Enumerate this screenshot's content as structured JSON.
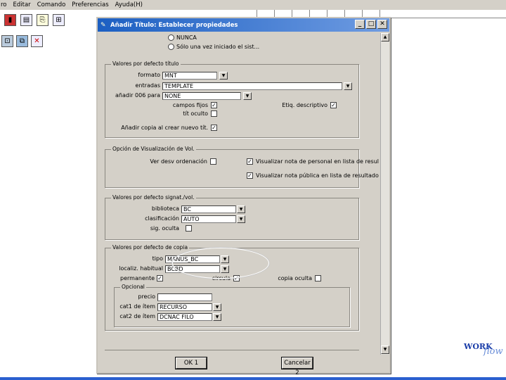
{
  "menu": [
    "ro",
    "Editar",
    "Comando",
    "Preferencias",
    "Ayuda(H)"
  ],
  "dialog": {
    "title": "Añadir Título: Establecer propiedades",
    "radios": [
      "NUNCA",
      "Sólo una vez iniciado el sist..."
    ],
    "defaults_title": {
      "legend": "Valores por defecto título",
      "formato_label": "formato",
      "formato_value": "MNT",
      "entradas_label": "entradas",
      "entradas_value": "TEMPLATE",
      "anadir006_label": "añadir 006 para",
      "anadir006_value": "NONE",
      "campos_fijos_label": "campos fijos",
      "tit_oculto_label": "tít oculto",
      "etiq_descriptivo_label": "Etiq. descriptivo",
      "anadir_copia_label": "Añadir copia al crear nuevo tít."
    },
    "view_options": {
      "legend": "Opción de Visualización de Vol.",
      "ver_orden_label": "Ver desv ordenación",
      "nota_personal_label": "Visualizar nota de personal en lista de resul",
      "nota_publica_label": "Visualizar nota pública en lista de resultado"
    },
    "call_number": {
      "legend": "Valores por defecto signat./vol.",
      "biblioteca_label": "biblioteca",
      "biblioteca_value": "BC",
      "clasificacion_label": "clasificación",
      "clasificacion_value": "AUTO",
      "sig_oculta_label": "sig. oculta"
    },
    "copy_defaults": {
      "legend": "Valores por defecto de copia",
      "tipo_label": "tipo",
      "tipo_value": "MANUS_BC",
      "localiz_label": "localiz. habitual",
      "localiz_value": "BCBD",
      "permanente_label": "permanente",
      "circula_label": "circula",
      "copia_oculta_label": "copia oculta"
    },
    "optional": {
      "legend": "Opcional",
      "precio_label": "precio",
      "precio_value": "",
      "cat1_label": "cat1 de ítem",
      "cat1_value": "RECURSO",
      "cat2_label": "cat2 de ítem",
      "cat2_value": "DCNAC FILO"
    },
    "ok_label": "OK  1",
    "cancel_label": "Cancelar  2"
  },
  "checks": {
    "campos_fijos": true,
    "tit_oculto": false,
    "etiq_descriptivo": true,
    "anadir_copia": true,
    "ver_orden": false,
    "nota_personal": true,
    "nota_publica": true,
    "sig_oculta": false,
    "permanente": true,
    "circula": true,
    "copia_oculta": false
  },
  "logo": {
    "word1": "WORK",
    "word2": "flow"
  }
}
